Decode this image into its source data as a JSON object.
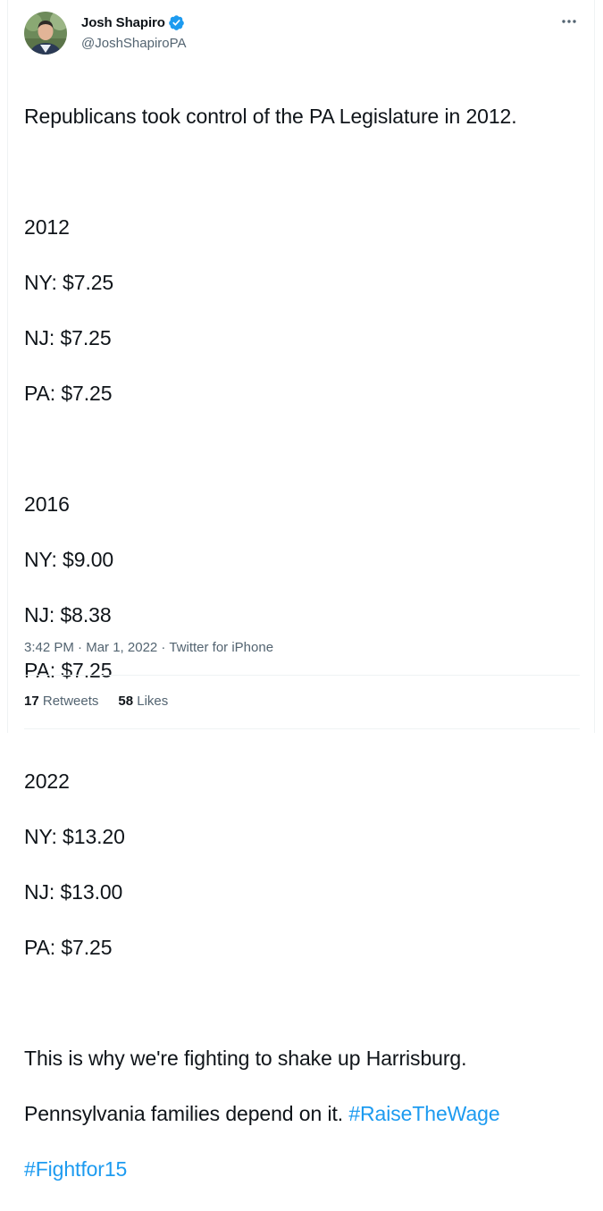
{
  "author": {
    "display_name": "Josh Shapiro",
    "handle": "@JoshShapiroPA",
    "verified": true
  },
  "tweet": {
    "lines": [
      "Republicans took control of the PA Legislature in 2012.",
      "",
      "2012",
      "NY: $7.25",
      "NJ: $7.25",
      "PA: $7.25",
      "",
      "2016",
      "NY: $9.00",
      "NJ: $8.38",
      "PA: $7.25",
      "",
      "2022",
      "NY: $13.20",
      "NJ: $13.00",
      "PA: $7.25",
      "",
      "This is why we're fighting to shake up Harrisburg."
    ],
    "last_line_text": "Pennsylvania families depend on it. ",
    "hashtag_1": "#RaiseTheWage",
    "hashtag_2": "#Fightfor15"
  },
  "meta": {
    "time": "3:42 PM",
    "date": "Mar 1, 2022",
    "source": "Twitter for iPhone",
    "separator": " · "
  },
  "stats": {
    "retweets_count": "17",
    "retweets_label": "Retweets",
    "likes_count": "58",
    "likes_label": "Likes"
  },
  "colors": {
    "link": "#1d9bf0",
    "secondary_text": "#536471",
    "primary_text": "#0f1419",
    "verified_badge": "#1d9bf0"
  },
  "icons": {
    "verified": "verified-badge-icon",
    "more": "more-options-icon"
  }
}
